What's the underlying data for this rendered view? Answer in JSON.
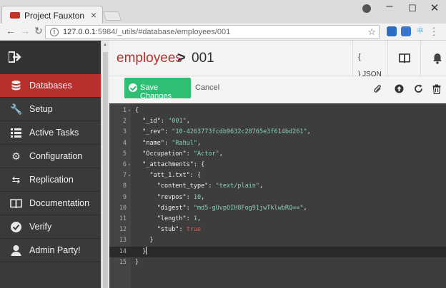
{
  "browser": {
    "tab_title": "Project Fauxton",
    "tab_close": "×",
    "url_host": "127.0.0.1",
    "url_path": ":5984/_utils/#database/employees/001",
    "info_glyph": "i"
  },
  "sidebar": {
    "items": [
      {
        "label": "Databases",
        "icon": "database-icon",
        "active": true
      },
      {
        "label": "Setup",
        "icon": "wrench-icon",
        "active": false
      },
      {
        "label": "Active Tasks",
        "icon": "list-icon",
        "active": false
      },
      {
        "label": "Configuration",
        "icon": "gear-icon",
        "active": false
      },
      {
        "label": "Replication",
        "icon": "replication-icon",
        "active": false
      },
      {
        "label": "Documentation",
        "icon": "book-icon",
        "active": false
      },
      {
        "label": "Verify",
        "icon": "check-circle-icon",
        "active": false
      },
      {
        "label": "Admin Party!",
        "icon": "user-icon",
        "active": false
      }
    ]
  },
  "header": {
    "database": "employees",
    "separator": ">",
    "document": "001",
    "json_brace": "{",
    "json_label": "} JSON"
  },
  "toolbar": {
    "save_label": "Save Changes",
    "cancel_label": "Cancel"
  },
  "editor": {
    "lines": [
      "{",
      "  \"_id\": \"001\",",
      "  \"_rev\": \"10-4263773fcdb9632c28765e3f614bd261\",",
      "  \"name\": \"Rahul\",",
      "  \"Occupation\": \"Actor\",",
      "  \"_attachments\": {",
      "    \"att_1.txt\": {",
      "      \"content_type\": \"text/plain\",",
      "      \"revpos\": 10,",
      "      \"digest\": \"md5-gUvpOIH8Fog91jwTklwbRQ==\",",
      "      \"length\": 1,",
      "      \"stub\": true",
      "    }",
      "  }",
      "}"
    ],
    "active_line": 14,
    "fold_lines": [
      1,
      6,
      7
    ]
  },
  "colors": {
    "accent": "#b8302c",
    "save": "#2ebf75",
    "editor_bg": "#3d3d3d",
    "sidebar_bg": "#3a3a3a"
  }
}
